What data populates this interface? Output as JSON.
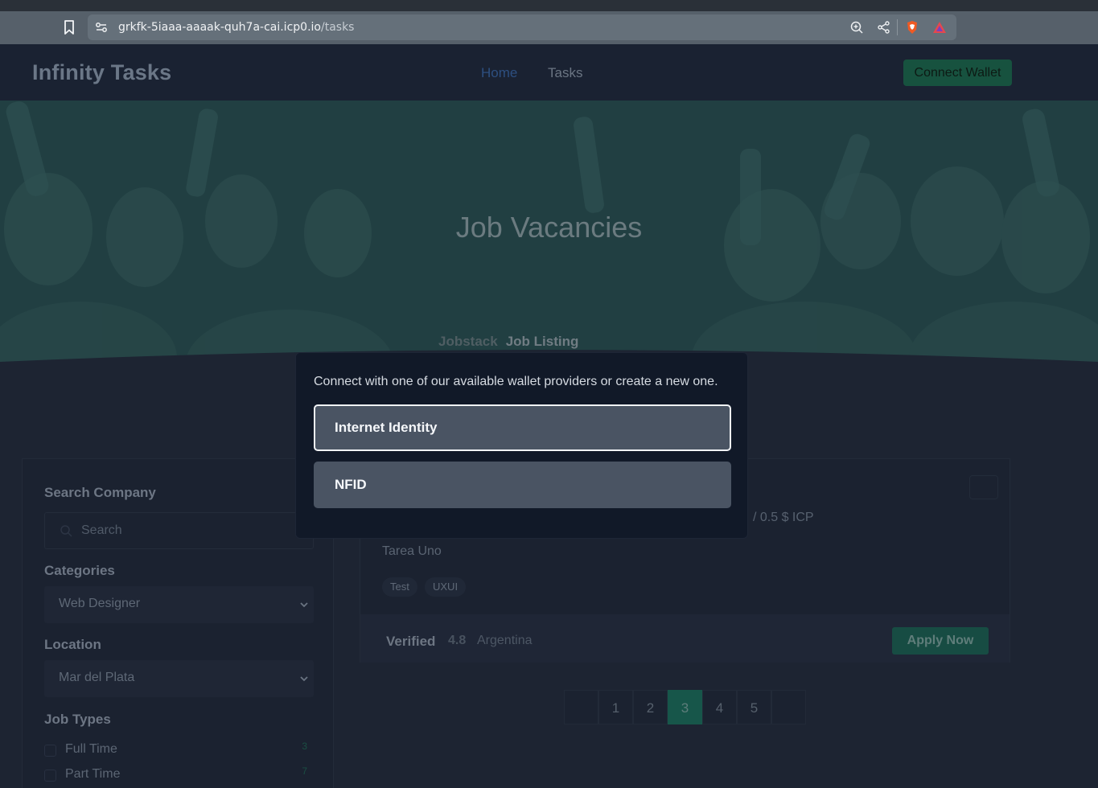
{
  "browser": {
    "url_host": "grkfk-5iaaa-aaaak-quh7a-cai.icp0.io",
    "url_path": "/tasks",
    "icons": [
      "bookmark-icon",
      "site-settings-icon",
      "zoom-icon",
      "share-icon",
      "brave-shield-icon",
      "brave-rewards-icon"
    ]
  },
  "header": {
    "brand": "Infinity Tasks",
    "nav": [
      {
        "label": "Home",
        "active": true
      },
      {
        "label": "Tasks",
        "active": false
      }
    ],
    "connect_label": "Connect Wallet"
  },
  "hero": {
    "title": "Job Vacancies",
    "breadcrumb": {
      "first": "Jobstack",
      "current": "Job Listing"
    }
  },
  "sidebar": {
    "search_heading": "Search Company",
    "search_placeholder": "Search",
    "categories_heading": "Categories",
    "category_value": "Web Designer",
    "location_heading": "Location",
    "location_value": "Mar del Plata",
    "job_types_heading": "Job Types",
    "job_types": [
      {
        "label": "Full Time",
        "count": "3"
      },
      {
        "label": "Part Time",
        "count": "7"
      }
    ]
  },
  "job_card": {
    "salary": "/ 0.5 $ ICP",
    "description": "Tarea Uno",
    "tags": [
      "Test",
      "UXUI"
    ],
    "verified": "Verified",
    "rating": "4.8",
    "location": "Argentina",
    "apply_label": "Apply Now"
  },
  "pagination": {
    "pages": [
      "1",
      "2",
      "3",
      "4",
      "5"
    ],
    "active_page": "3"
  },
  "modal": {
    "message": "Connect with one of our available wallet providers or create a new one.",
    "providers": [
      "Internet Identity",
      "NFID"
    ]
  },
  "colors": {
    "accent_green": "#17564a",
    "modal_bg": "#111928",
    "provider_btn": "#4a5463"
  }
}
